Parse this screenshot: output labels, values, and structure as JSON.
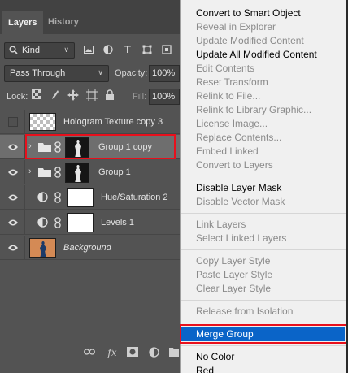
{
  "tabs": [
    {
      "label": "Layers",
      "active": true
    },
    {
      "label": "History",
      "active": false
    }
  ],
  "filter": {
    "kind_label": "Kind",
    "icons": [
      "image-filter-icon",
      "adjustment-filter-icon",
      "type-filter-icon",
      "shape-filter-icon",
      "smart-object-filter-icon"
    ]
  },
  "blend": {
    "mode": "Pass Through",
    "opacity_label": "Opacity:",
    "opacity_value": "100%"
  },
  "lock": {
    "label": "Lock:",
    "icons": [
      "lock-transparent-pixels-icon",
      "lock-image-pixels-icon",
      "lock-position-icon",
      "lock-artboard-icon",
      "lock-all-icon"
    ],
    "fill_label": "Fill:",
    "fill_value": "100%"
  },
  "layers": [
    {
      "name": "Hologram Texture copy 3",
      "visible": false,
      "type": "pixel",
      "selected": false
    },
    {
      "name": "Group 1 copy",
      "visible": true,
      "type": "group",
      "selected": true
    },
    {
      "name": "Group 1",
      "visible": true,
      "type": "group",
      "selected": false
    },
    {
      "name": "Hue/Saturation 2",
      "visible": true,
      "type": "adjustment",
      "selected": false
    },
    {
      "name": "Levels 1",
      "visible": true,
      "type": "adjustment",
      "selected": false
    },
    {
      "name": "Background",
      "visible": true,
      "type": "background",
      "selected": false
    }
  ],
  "bottom_icons": [
    "link-layers-icon",
    "fx-icon",
    "mask-icon",
    "adjustment-layer-icon",
    "new-group-icon"
  ],
  "menu": {
    "items": [
      {
        "label": "Convert to Smart Object",
        "enabled": true
      },
      {
        "label": "Reveal in Explorer",
        "enabled": false
      },
      {
        "label": "Update Modified Content",
        "enabled": false
      },
      {
        "label": "Update All Modified Content",
        "enabled": true
      },
      {
        "label": "Edit Contents",
        "enabled": false
      },
      {
        "label": "Reset Transform",
        "enabled": false
      },
      {
        "label": "Relink to File...",
        "enabled": false
      },
      {
        "label": "Relink to Library Graphic...",
        "enabled": false
      },
      {
        "label": "License Image...",
        "enabled": false
      },
      {
        "label": "Replace Contents...",
        "enabled": false
      },
      {
        "label": "Embed Linked",
        "enabled": false
      },
      {
        "label": "Convert to Layers",
        "enabled": false
      },
      {
        "label": "Disable Layer Mask",
        "enabled": true
      },
      {
        "label": "Disable Vector Mask",
        "enabled": false
      },
      {
        "label": "Link Layers",
        "enabled": false
      },
      {
        "label": "Select Linked Layers",
        "enabled": false
      },
      {
        "label": "Copy Layer Style",
        "enabled": false
      },
      {
        "label": "Paste Layer Style",
        "enabled": false
      },
      {
        "label": "Clear Layer Style",
        "enabled": false
      },
      {
        "label": "Release from Isolation",
        "enabled": false
      },
      {
        "label": "Merge Group",
        "enabled": true,
        "highlighted": true
      },
      {
        "label": "No Color",
        "enabled": true
      },
      {
        "label": "Red",
        "enabled": true
      }
    ]
  },
  "colors": {
    "panel_bg": "#535353",
    "selected_row": "#6e6e6e",
    "menu_bg": "#f0f0f0",
    "menu_highlight": "#0a64c8",
    "annotation_red": "#e8101c"
  }
}
